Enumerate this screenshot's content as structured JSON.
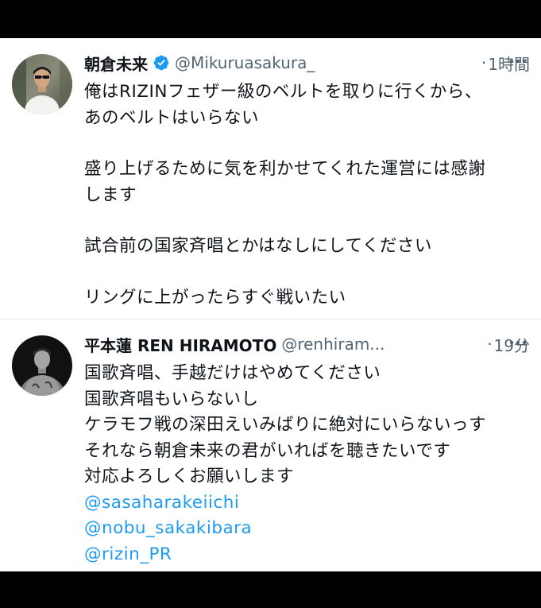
{
  "tweets": [
    {
      "name": "朝倉未来",
      "verified": true,
      "handle": "@Mikuruasakura_",
      "separator": "·",
      "time": "1時間",
      "paragraphs": [
        [
          "俺はRIZINフェザー級のベルトを取りに行くから、",
          "あのベルトはいらない"
        ],
        [
          "盛り上げるために気を利かせてくれた運営には感謝",
          "します"
        ],
        [
          "試合前の国家斉唱とかはなしにしてください"
        ],
        [
          "リングに上がったらすぐ戦いたい"
        ]
      ]
    },
    {
      "name": "平本蓮 REN HIRAMOTO",
      "verified": false,
      "handle": "@renhiram...",
      "separator": "·",
      "time": "19分",
      "lines": [
        "国歌斉唱、手越だけはやめてください",
        "国歌斉唱もいらないし",
        "ケラモフ戦の深田えいみばりに絶対にいらないっす",
        "それなら朝倉未来の君がいればを聴きたいです",
        "対応よろしくお願いします"
      ],
      "mentions": [
        "@sasaharakeiichi",
        "@nobu_sakakibara",
        "@rizin_PR"
      ]
    }
  ],
  "icons": {
    "verified": "verified-badge-icon",
    "more": "more-options-icon"
  },
  "colors": {
    "background": "#000000",
    "card": "#ffffff",
    "text": "#0f1419",
    "secondary": "#536471",
    "link": "#1d9bf0",
    "verified": "#1d9bf0"
  }
}
